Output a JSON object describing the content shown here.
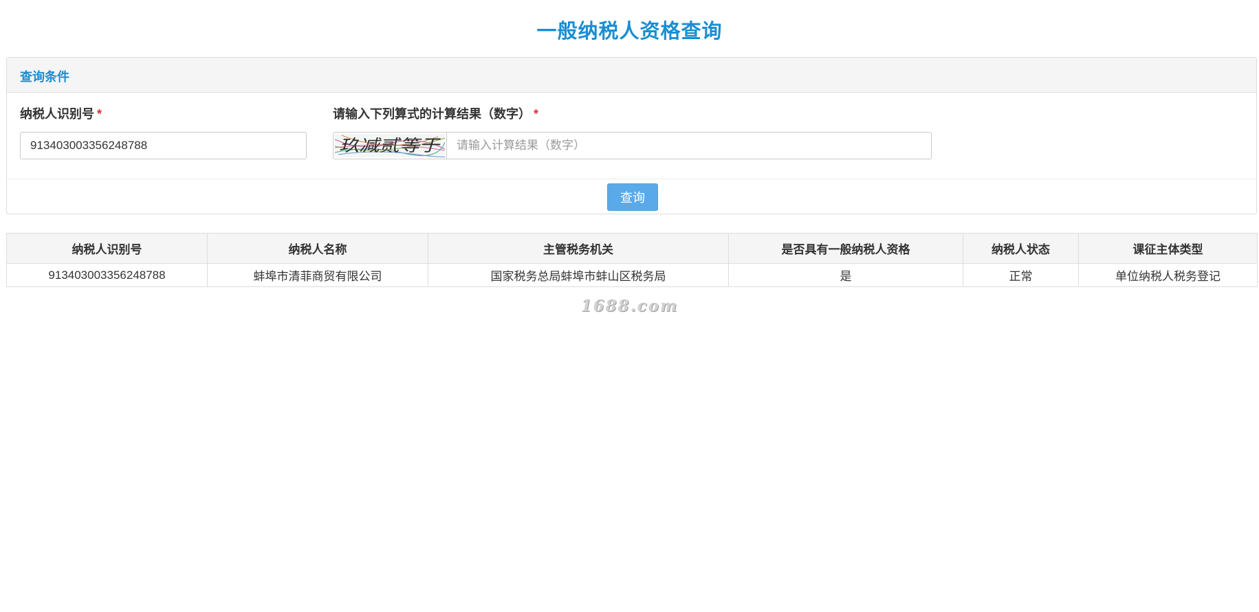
{
  "page": {
    "title": "一般纳税人资格查询",
    "accent_color": "#1a8ed1",
    "button_color": "#5aaaea",
    "required_color": "#d9302c"
  },
  "query_panel": {
    "heading": "查询条件",
    "taxpayer_id_label": "纳税人识别号",
    "taxpayer_id_value": "913403003356248788",
    "captcha_label": "请输入下列算式的计算结果（数字）",
    "required_mark": "*",
    "captcha_text": "玖减贰等于",
    "captcha_placeholder": "请输入计算结果（数字）",
    "captcha_value": "",
    "query_button_label": "查询"
  },
  "results": {
    "columns": [
      "纳税人识别号",
      "纳税人名称",
      "主管税务机关",
      "是否具有一般纳税人资格",
      "纳税人状态",
      "课征主体类型"
    ],
    "rows": [
      [
        "913403003356248788",
        "蚌埠市清菲商贸有限公司",
        "国家税务总局蚌埠市蚌山区税务局",
        "是",
        "正常",
        "单位纳税人税务登记"
      ]
    ]
  },
  "watermark": {
    "text": "1688.com"
  }
}
